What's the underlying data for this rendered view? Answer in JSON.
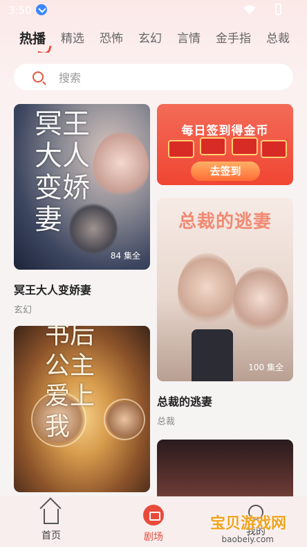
{
  "status_bar": {
    "time": "3:50"
  },
  "tabs": [
    "热播",
    "精选",
    "恐怖",
    "玄幻",
    "言情",
    "金手指",
    "总裁"
  ],
  "search": {
    "placeholder": "搜索"
  },
  "cards": {
    "left": [
      {
        "title": "冥王大人变娇妻",
        "genre": "玄幻",
        "episodes": "84 集全",
        "art_text": "冥王大人变娇妻"
      },
      {
        "title": "",
        "genre": "",
        "episodes": "",
        "art_text": "书后公主爱上我"
      }
    ],
    "right_banner": {
      "title": "每日签到得金币",
      "button": "去签到"
    },
    "right": [
      {
        "title": "总裁的逃妻",
        "genre": "总裁",
        "episodes": "100 集全",
        "art_text": "总裁的逃妻"
      }
    ]
  },
  "bottom_nav": [
    {
      "label": "首页",
      "icon": "home-icon"
    },
    {
      "label": "剧场",
      "icon": "drama-icon",
      "active": true
    },
    {
      "label": "我的",
      "icon": "user-icon"
    }
  ],
  "watermark": {
    "text": "宝贝游戏网",
    "url": "baobeiy.com"
  },
  "colors": {
    "accent": "#e84b3c",
    "banner": "#ef4633"
  }
}
